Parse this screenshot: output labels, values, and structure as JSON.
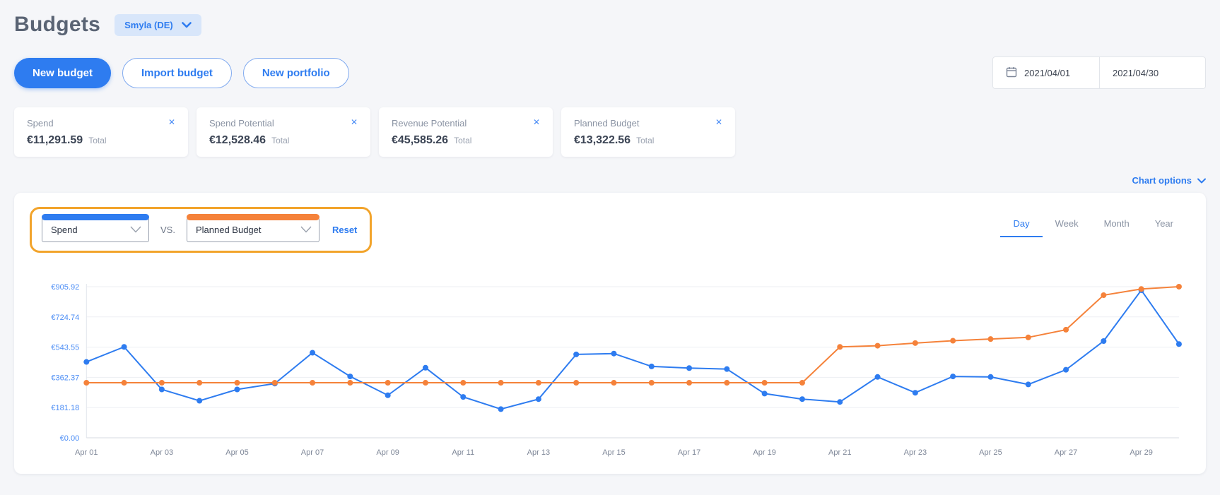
{
  "page": {
    "title": "Budgets",
    "account_selector": "Smyla (DE)"
  },
  "toolbar": {
    "new_budget": "New budget",
    "import_budget": "Import budget",
    "new_portfolio": "New portfolio"
  },
  "date_range": {
    "start": "2021/04/01",
    "end": "2021/04/30"
  },
  "icons": {
    "close": "✕"
  },
  "metric_cards": [
    {
      "label": "Spend",
      "value": "€11,291.59",
      "suffix": "Total"
    },
    {
      "label": "Spend Potential",
      "value": "€12,528.46",
      "suffix": "Total"
    },
    {
      "label": "Revenue Potential",
      "value": "€45,585.26",
      "suffix": "Total"
    },
    {
      "label": "Planned Budget",
      "value": "€13,322.56",
      "suffix": "Total"
    }
  ],
  "chart_options_label": "Chart options",
  "compare": {
    "left_value": "Spend",
    "vs_label": "VS.",
    "right_value": "Planned Budget",
    "reset_label": "Reset"
  },
  "granularity_tabs": [
    {
      "label": "Day",
      "active": true
    },
    {
      "label": "Week",
      "active": false
    },
    {
      "label": "Month",
      "active": false
    },
    {
      "label": "Year",
      "active": false
    }
  ],
  "chart_data": {
    "type": "line",
    "x": [
      "Apr 01",
      "Apr 02",
      "Apr 03",
      "Apr 04",
      "Apr 05",
      "Apr 06",
      "Apr 07",
      "Apr 08",
      "Apr 09",
      "Apr 10",
      "Apr 11",
      "Apr 12",
      "Apr 13",
      "Apr 14",
      "Apr 15",
      "Apr 16",
      "Apr 17",
      "Apr 18",
      "Apr 19",
      "Apr 20",
      "Apr 21",
      "Apr 22",
      "Apr 23",
      "Apr 24",
      "Apr 25",
      "Apr 26",
      "Apr 27",
      "Apr 28",
      "Apr 29",
      "Apr 30"
    ],
    "series": [
      {
        "name": "Spend",
        "color": "#2e7cf0",
        "values": [
          455,
          545,
          290,
          222,
          290,
          325,
          510,
          368,
          255,
          420,
          245,
          172,
          232,
          500,
          505,
          428,
          418,
          412,
          265,
          232,
          215,
          365,
          270,
          368,
          365,
          320,
          408,
          580,
          885,
          562
        ]
      },
      {
        "name": "Planned Budget",
        "color": "#f5823a",
        "values": [
          330,
          330,
          330,
          330,
          330,
          330,
          330,
          330,
          330,
          330,
          330,
          330,
          330,
          330,
          330,
          330,
          330,
          330,
          330,
          330,
          545,
          552,
          568,
          582,
          592,
          602,
          648,
          855,
          892,
          906
        ]
      }
    ],
    "y_ticks": [
      0,
      181.18,
      362.37,
      543.55,
      724.74,
      905.92
    ],
    "y_tick_labels": [
      "€0.00",
      "€181.18",
      "€362.37",
      "€543.55",
      "€724.74",
      "€905.92"
    ],
    "ylim": [
      0,
      905.92
    ],
    "x_tick_every": 2,
    "grid": true,
    "legend_position": "none",
    "title": "",
    "xlabel": "",
    "ylabel": ""
  }
}
